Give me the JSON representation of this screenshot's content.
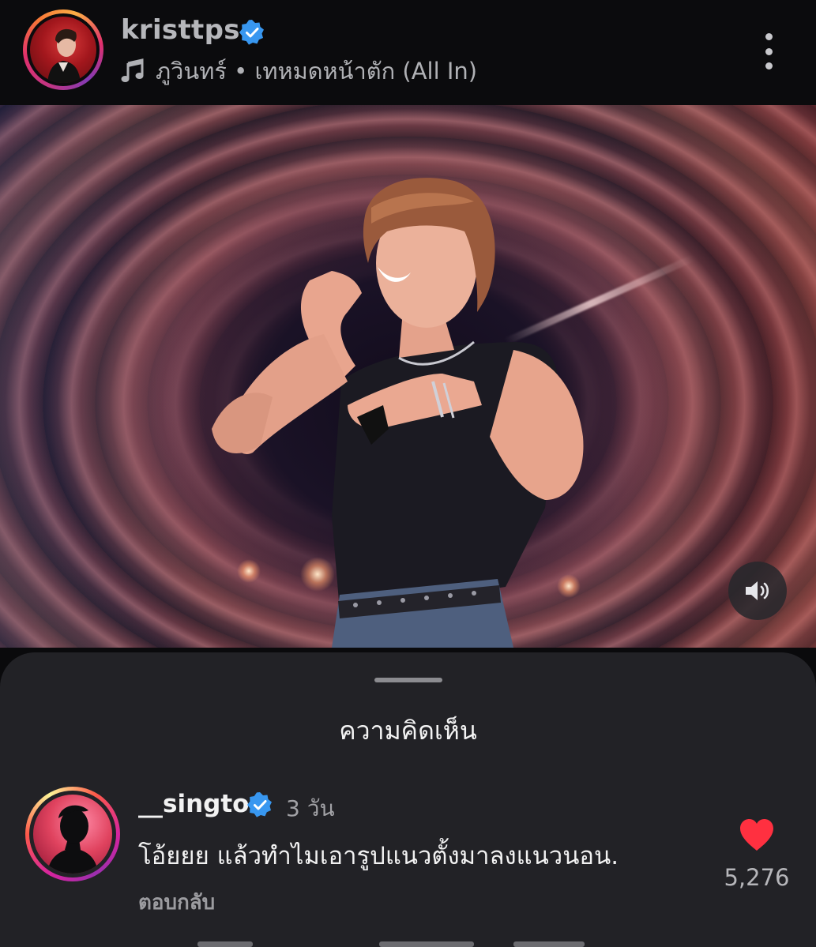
{
  "post": {
    "username": "kristtps",
    "verified": true,
    "audio": "ภูวินทร์ • เทหมดหน้าตัก (All In)"
  },
  "icons": {
    "music": "music-note-icon",
    "more": "more-vertical-icon",
    "sound": "speaker-volume-icon",
    "verified": "verified-badge-icon",
    "like": "heart-filled-icon"
  },
  "colors": {
    "verified": "#3897f0",
    "like": "#ff3040",
    "sheet_bg": "#222226",
    "header_bg": "#0b0b0d"
  },
  "comments_sheet": {
    "title": "ความคิดเห็น",
    "comments": [
      {
        "username": "__singto",
        "verified": true,
        "time": "3 วัน",
        "text": "โอ้ยยย แล้วทำไมเอารูปแนวตั้งมาลงแนวนอน.",
        "reply_label": "ตอบกลับ",
        "likes": "5,276",
        "liked": true
      }
    ]
  }
}
